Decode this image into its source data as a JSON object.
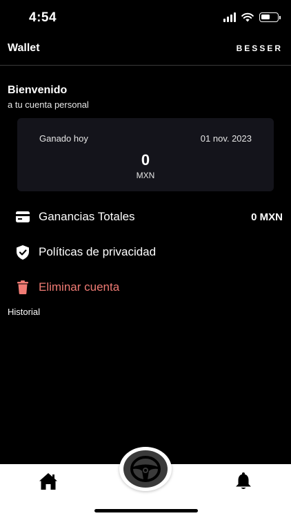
{
  "status_bar": {
    "time": "4:54"
  },
  "header": {
    "title": "Wallet",
    "brand": "BESSER"
  },
  "welcome": {
    "title": "Bienvenido",
    "subtitle": "a tu cuenta personal"
  },
  "earnings_card": {
    "label": "Ganado hoy",
    "date": "01 nov. 2023",
    "amount": "0",
    "currency": "MXN"
  },
  "menu": {
    "total_earnings": {
      "label": "Ganancias Totales",
      "value": "0 MXN",
      "icon": "credit-card-icon"
    },
    "privacy": {
      "label": "Políticas de privacidad",
      "icon": "shield-check-icon"
    },
    "delete_account": {
      "label": "Eliminar cuenta",
      "icon": "trash-icon",
      "color": "#f07b74"
    }
  },
  "history": {
    "label": "Historial"
  },
  "tab_bar": {
    "home_icon": "home-icon",
    "center_icon": "steering-wheel-icon",
    "bell_icon": "bell-icon"
  }
}
